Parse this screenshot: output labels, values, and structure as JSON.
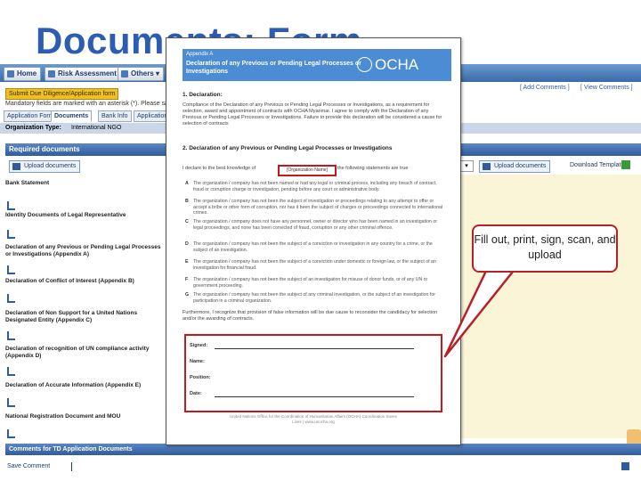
{
  "slide": {
    "title": "Documents: Form"
  },
  "app": {
    "nav": {
      "home": "Home",
      "risk": "Risk Assessment",
      "others": "Others"
    },
    "due_diligence_button": "Submit Due Diligence/Application form",
    "required_note": "Mandatory fields are marked with an asterisk (*). Please save your",
    "tabs": [
      "Application Form",
      "Documents",
      "Bank Info",
      "Application"
    ],
    "org_type_label": "Organization Type:",
    "org_type_value": "International NGO",
    "links": {
      "add_comments": "[ Add Comments ]",
      "view_comments": "[ View Comments ]"
    },
    "required_documents_header": "Required documents",
    "upload_button": "Upload documents",
    "upload_button_right": "Upload documents",
    "download_template": "Download Template",
    "documents": [
      "Bank Statement",
      "Identity Documents of Legal Representative",
      "Declaration of any Previous or Pending Legal Processes or Investigations (Appendix A)",
      "Declaration of Conflict of Interest (Appendix B)",
      "Declaration of Non Support for a United Nations Designated Entity (Appendix C)",
      "Declaration of recognition of UN compliance activity (Appendix D)",
      "Declaration of Accurate Information (Appendix E)",
      "National Registration Document and MOU"
    ],
    "comments_header": "Comments for TD Application Documents",
    "save_comment": "Save Comment"
  },
  "document": {
    "appendix": "Appendix A",
    "title": "Declaration of any Previous or Pending Legal Processes or Investigations",
    "brand": "OCHA",
    "section1": "1. Declaration:",
    "section1_text": "Compliance of the Declaration of any Previous or Pending Legal Processes or Investigations, as a requirement for selection, award and appointment of contracts with OCHA Myanmar. I agree to comply with the Declaration of any Previous or Pending Legal Processes or Investigations. Failure to provide this declaration will be considered a cause for selection of contracts",
    "section2": "2. Declaration of any Previous or Pending Legal Processes or Investigations",
    "declare_prefix": "I declare to the best knowledge of",
    "org_field": "[Organization Name]",
    "declare_suffix": "the following statements are true",
    "options": [
      {
        "letter": "A",
        "text": "The organization / company has not been named or had any legal or criminal process, including any breach of contract, fraud or corruption charge or investigation, pending before any court or administrative body."
      },
      {
        "letter": "B",
        "text": "The organization / company has not been the subject of investigation or proceedings relating to any attempt to offer or accept a bribe or other form of corruption, nor has it been the subject of charges or proceedings connected to international crimes."
      },
      {
        "letter": "C",
        "text": "The organization / company does not have any personnel, owner or director who has been named in an investigation or legal proceedings, and none has been convicted of fraud, corruption or any other criminal offence."
      },
      {
        "letter": "D",
        "text": "The organization / company has not been the subject of a conviction or investigation in any country for a crime, or the subject of an investigation."
      },
      {
        "letter": "E",
        "text": "The organization / company has not been the subject of a conviction under domestic or foreign law, or the subject of an investigation for financial fraud."
      },
      {
        "letter": "F",
        "text": "The organization / company has not been the subject of an investigation for misuse of donor funds, or of any UN or government proceeding."
      },
      {
        "letter": "G",
        "text": "The organization / company has not been the subject of any criminal investigation, or the subject of an investigation for participation in a criminal organization."
      }
    ],
    "closing": "Furthermore, I recognize that provision of false information will be due cause to reconsider the candidacy for selection and/or the awarding of contracts.",
    "signed_label": "Signed:",
    "name_label": "Name:",
    "position_label": "Position:",
    "date_label": "Date:",
    "footer": "United Nations Office for the Coordination of Humanitarian Affairs (OCHA) Coordination Saves Lives | www.unocha.org"
  },
  "callout": {
    "text": "Fill out, print, sign, scan, and upload"
  },
  "colors": {
    "title": "#2d5db3",
    "callout_border": "#b81f27",
    "highlight": "#c4181b",
    "doc_header": "#4b8cd4"
  }
}
